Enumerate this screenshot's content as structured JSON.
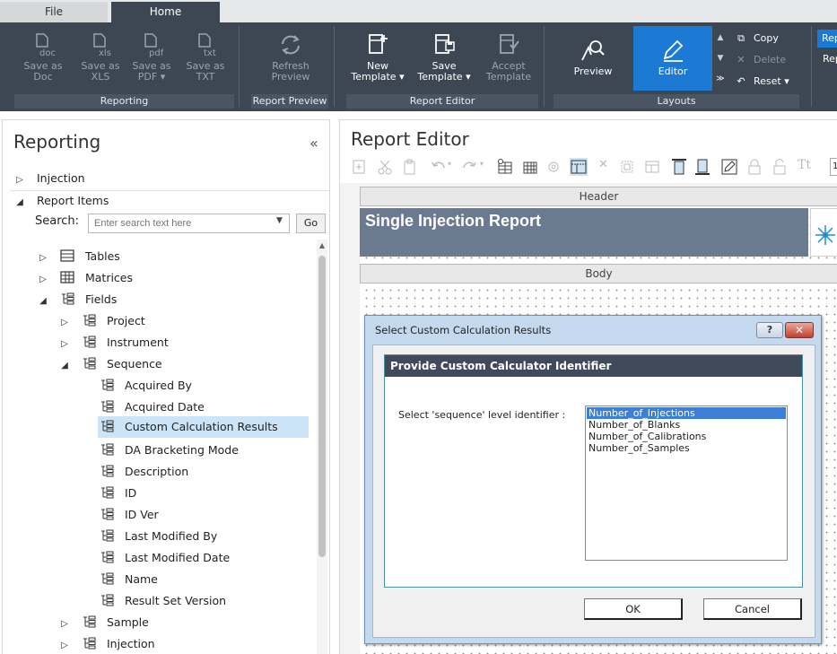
{
  "tabs": {
    "file": "File",
    "home": "Home"
  },
  "ribbon": {
    "reporting": {
      "group_label": "Reporting",
      "save_doc_line1": "Save as",
      "save_doc_line2": "Doc",
      "doc_icon_text": "doc",
      "save_xls_line1": "Save as",
      "save_xls_line2": "XLS",
      "xls_icon_text": "xls",
      "save_pdf_line1": "Save as",
      "save_pdf_line2": "PDF",
      "pdf_icon_text": "pdf",
      "save_txt_line1": "Save as",
      "save_txt_line2": "TXT",
      "txt_icon_text": "txt"
    },
    "report_preview": {
      "group_label": "Report Preview",
      "refresh_line1": "Refresh",
      "refresh_line2": "Preview"
    },
    "report_editor": {
      "group_label": "Report Editor",
      "new_line1": "New",
      "new_line2": "Template",
      "save_line1": "Save",
      "save_line2": "Template",
      "accept_line1": "Accept",
      "accept_line2": "Template"
    },
    "layouts": {
      "group_label": "Layouts",
      "preview": "Preview",
      "editor": "Editor",
      "copy": "Copy",
      "delete": "Delete",
      "reset": "Reset"
    },
    "rep_1": "Rep",
    "rep_2": "Rep"
  },
  "left_panel": {
    "title": "Reporting",
    "injection": "Injection",
    "report_items": "Report Items",
    "search_label": "Search:",
    "search_placeholder": "Enter search text here",
    "go": "Go",
    "tree": {
      "tables": "Tables",
      "matrices": "Matrices",
      "fields": "Fields",
      "project": "Project",
      "instrument": "Instrument",
      "sequence": "Sequence",
      "acquired_by": "Acquired By",
      "acquired_date": "Acquired Date",
      "custom_calc": "Custom Calculation Results",
      "da_bracketing": "DA Bracketing Mode",
      "description": "Description",
      "id": "ID",
      "id_ver": "ID Ver",
      "last_modified_by": "Last Modified By",
      "last_modified_date": "Last Modified Date",
      "name": "Name",
      "result_set_version": "Result Set Version",
      "sample": "Sample",
      "injection": "Injection"
    }
  },
  "right_panel": {
    "title": "Report Editor",
    "zoom": "10",
    "header_band": "Header",
    "report_title": "Single Injection Report",
    "body_band": "Body"
  },
  "dialog": {
    "title": "Select Custom Calculation Results",
    "help": "?",
    "close": "✕",
    "group_header": "Provide Custom Calculator Identifier",
    "label": "Select 'sequence' level identifier :",
    "options": [
      "Number_of_Injections",
      "Number_of_Blanks",
      "Number_of_Calibrations",
      "Number_of_Samples"
    ],
    "ok": "OK",
    "cancel": "Cancel"
  },
  "colors": {
    "ribbon_bg": "#3d4754",
    "accent": "#1d7ad4",
    "selection": "#cce4f7",
    "dialog_header": "#3f4a5a",
    "report_title_bg": "#6b7a8e"
  }
}
